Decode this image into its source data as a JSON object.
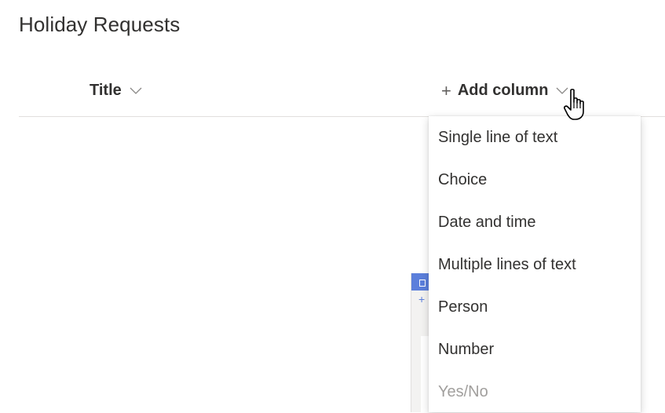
{
  "page": {
    "title": "Holiday Requests"
  },
  "columns": {
    "title_label": "Title",
    "add_column_label": "Add column"
  },
  "icons": {
    "plus": "plus-icon",
    "chevron": "chevron-down-icon",
    "cursor": "hand-pointer-icon"
  },
  "dropdown": {
    "items": [
      {
        "label": "Single line of text"
      },
      {
        "label": "Choice"
      },
      {
        "label": "Date and time"
      },
      {
        "label": "Multiple lines of text"
      },
      {
        "label": "Person"
      },
      {
        "label": "Number"
      },
      {
        "label": "Yes/No"
      }
    ]
  },
  "colors": {
    "text": "#323130",
    "divider": "#e1dfdd",
    "faded_text": "#a19f9d",
    "thumbnail_accent": "#5b7fdb"
  }
}
